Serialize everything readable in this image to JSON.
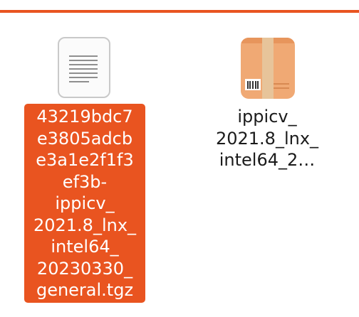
{
  "window": {
    "accent_color": "#e95420"
  },
  "files": [
    {
      "icon": "text-document-icon",
      "selected": true,
      "label_lines": [
        "43219bdc7",
        "e3805adcb",
        "e3a1e2f1f3",
        "ef3b-",
        "ippicv_",
        "2021.8_lnx_",
        "intel64_",
        "20230330_",
        "general.tgz"
      ]
    },
    {
      "icon": "package-archive-icon",
      "selected": false,
      "label_lines": [
        "ippicv_",
        "2021.8_lnx_",
        "intel64_2…"
      ]
    }
  ]
}
